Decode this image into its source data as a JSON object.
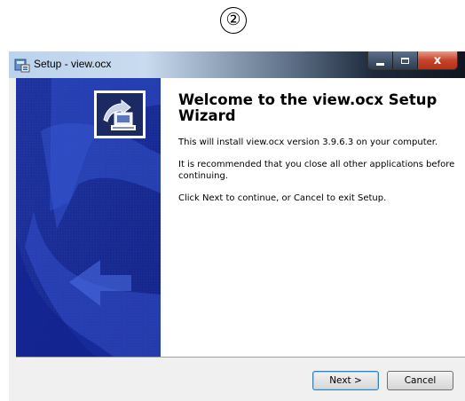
{
  "step_marker": "②",
  "window": {
    "title": "Setup - view.ocx",
    "controls": {
      "minimize_icon": "minimize-icon",
      "maximize_icon": "maximize-icon",
      "close_label": "x"
    }
  },
  "welcome": {
    "heading": "Welcome to the view.ocx Setup Wizard",
    "paragraphs": [
      "This will install view.ocx version 3.9.6.3 on your computer.",
      "It is recommended that you close all other applications before continuing.",
      "Click Next to continue, or Cancel to exit Setup."
    ]
  },
  "buttons": {
    "next": "Next >",
    "cancel": "Cancel"
  },
  "colors": {
    "wizard_sidebar": "#1a2f9e",
    "title_bar_left": "#c9dbef",
    "title_bar_right": "#10161f",
    "close_button": "#c7432a"
  }
}
